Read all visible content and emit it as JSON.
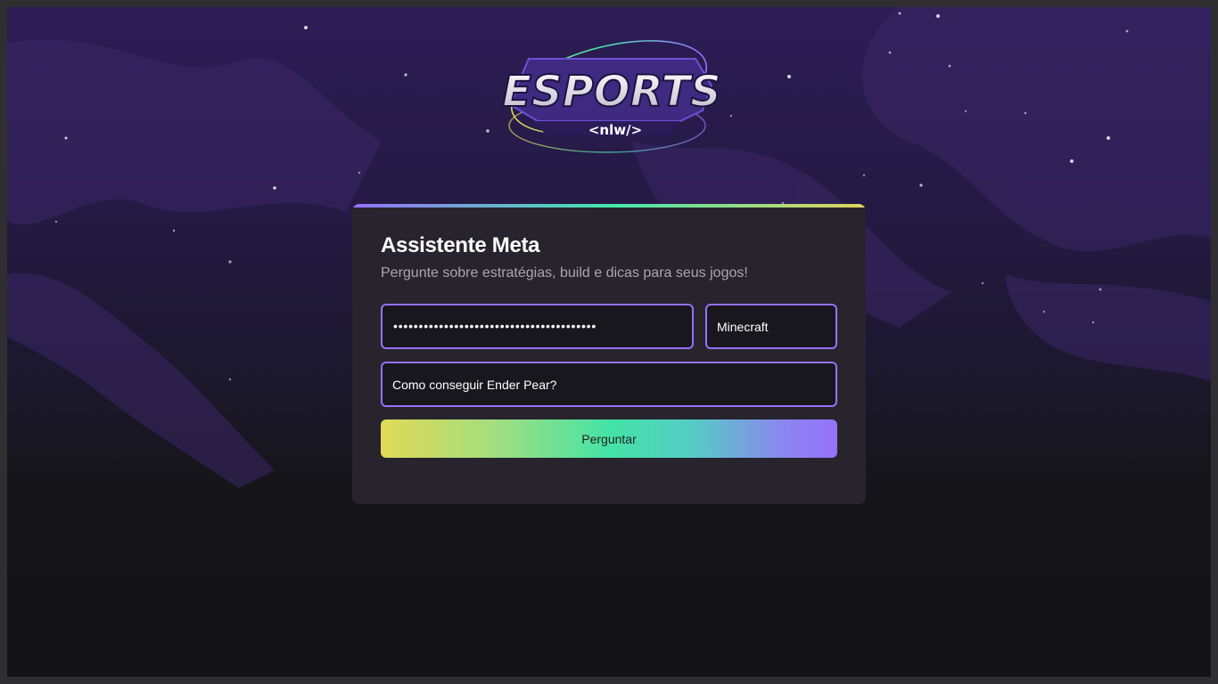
{
  "logo": {
    "title": "ESPORTS",
    "subtitle": "<nlw/>",
    "icon": "esports-nlw-logo"
  },
  "card": {
    "title": "Assistente Meta",
    "subtitle": "Pergunte sobre estratégias, build e dicas para seus jogos!"
  },
  "form": {
    "api_key_masked": "••••••••••••••••••••••••••••••••••••••••",
    "game_selected": "Minecraft",
    "question_value": "Como conseguir Ender Pear?",
    "submit_label": "Perguntar"
  },
  "colors": {
    "accent_purple": "#9572fc",
    "accent_green": "#43e7ad",
    "accent_yellow": "#e2d45c",
    "card_bg": "#27242e",
    "field_bg": "#19171e"
  }
}
